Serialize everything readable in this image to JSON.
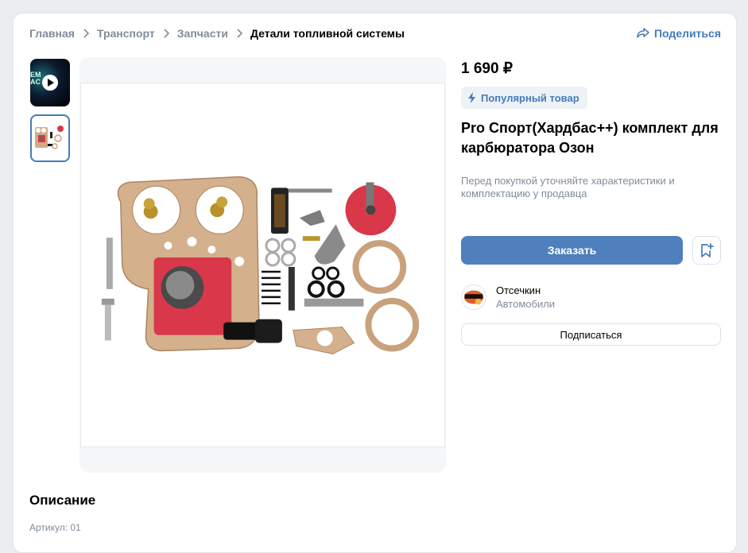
{
  "breadcrumb": [
    "Главная",
    "Транспорт",
    "Запчасти",
    "Детали топливной системы"
  ],
  "share_label": "Поделиться",
  "thumbnails": [
    {
      "type": "video",
      "text": "ЕМ\nAC"
    },
    {
      "type": "photo",
      "selected": true
    }
  ],
  "product": {
    "price": "1 690 ₽",
    "badge": "Популярный товар",
    "title": "Pro Спорт(Хардбас++) комплект для карбюратора Озон",
    "note": "Перед покупкой уточняйте характеристики и комплектацию у продавца"
  },
  "actions": {
    "order_label": "Заказать"
  },
  "seller": {
    "name": "Отсечкин",
    "category": "Автомобили",
    "subscribe_label": "Подписаться"
  },
  "description": {
    "heading": "Описание",
    "article": "Артикул: 01"
  },
  "colors": {
    "accent": "#447bba",
    "button": "#4f80bd",
    "muted": "#818c99"
  }
}
